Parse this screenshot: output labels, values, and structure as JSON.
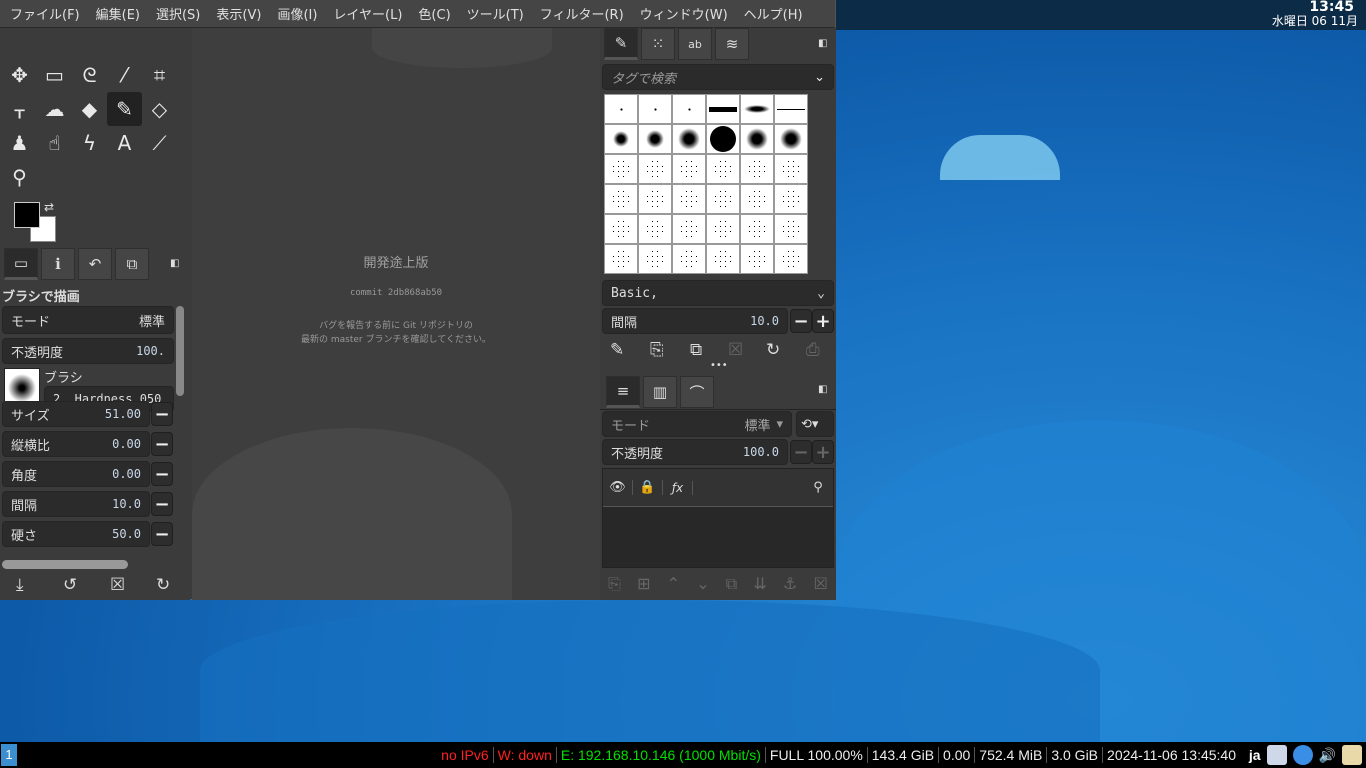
{
  "menu": [
    "ファイル(F)",
    "編集(E)",
    "選択(S)",
    "表示(V)",
    "画像(I)",
    "レイヤー(L)",
    "色(C)",
    "ツール(T)",
    "フィルター(R)",
    "ウィンドウ(W)",
    "ヘルプ(H)"
  ],
  "clock": {
    "time": "13:45",
    "date": "水曜日 06 11月"
  },
  "tools": [
    {
      "name": "move-tool",
      "g": "✥"
    },
    {
      "name": "rect-select-tool",
      "g": "▭"
    },
    {
      "name": "free-select-tool",
      "g": "ᘓ"
    },
    {
      "name": "fuzzy-select-tool",
      "g": "⁄"
    },
    {
      "name": "crop-tool",
      "g": "⌗"
    },
    {
      "name": "transform-tool",
      "g": "ᚁ"
    },
    {
      "name": "warp-tool",
      "g": "☁"
    },
    {
      "name": "bucket-fill-tool",
      "g": "◆"
    },
    {
      "name": "paintbrush-tool",
      "g": "✎"
    },
    {
      "name": "eraser-tool",
      "g": "◇"
    },
    {
      "name": "clone-tool",
      "g": "♟"
    },
    {
      "name": "smudge-tool",
      "g": "☝"
    },
    {
      "name": "paths-tool",
      "g": "ϟ"
    },
    {
      "name": "text-tool",
      "g": "A"
    },
    {
      "name": "color-picker-tool",
      "g": "⟋"
    },
    {
      "name": "zoom-tool",
      "g": "⚲"
    }
  ],
  "tool_options": {
    "title": "ブラシで描画",
    "mode_label": "モード",
    "mode_value": "標準",
    "opacity_label": "不透明度",
    "opacity_value": "100.",
    "brush_label": "ブラシ",
    "brush_name": "2. Hardness 050",
    "params": [
      {
        "label": "サイズ",
        "value": "51.00"
      },
      {
        "label": "縦横比",
        "value": "0.00"
      },
      {
        "label": "角度",
        "value": "0.00"
      },
      {
        "label": "間隔",
        "value": "10.0"
      },
      {
        "label": "硬さ",
        "value": "50.0"
      }
    ]
  },
  "canvas": {
    "title": "開発途上版",
    "commit": "commit 2db868ab50",
    "note1": "バグを報告する前に Git リポジトリの",
    "note2": "最新の master ブランチを確認してください。"
  },
  "brushes": {
    "search_placeholder": "タグで検索",
    "tag": "Basic,",
    "spacing_label": "間隔",
    "spacing_value": "10.0"
  },
  "layers": {
    "mode_label": "モード",
    "mode_value": "標準",
    "opacity_label": "不透明度",
    "opacity_value": "100.0"
  },
  "taskbar": {
    "workspace": "1",
    "items": [
      {
        "text": "no IPv6",
        "color": "#ff2020"
      },
      {
        "text": "W: down",
        "color": "#ff2020"
      },
      {
        "text": "E: 192.168.10.146 (1000 Mbit/s)",
        "color": "#00e000"
      },
      {
        "text": "FULL 100.00%",
        "color": "#eeeeee"
      },
      {
        "text": "143.4 GiB",
        "color": "#eeeeee"
      },
      {
        "text": "0.00",
        "color": "#eeeeee"
      },
      {
        "text": "752.4 MiB",
        "color": "#eeeeee"
      },
      {
        "text": "3.0 GiB",
        "color": "#eeeeee"
      },
      {
        "text": "2024-11-06 13:45:40",
        "color": "#eeeeee"
      }
    ],
    "lang": "ja"
  }
}
